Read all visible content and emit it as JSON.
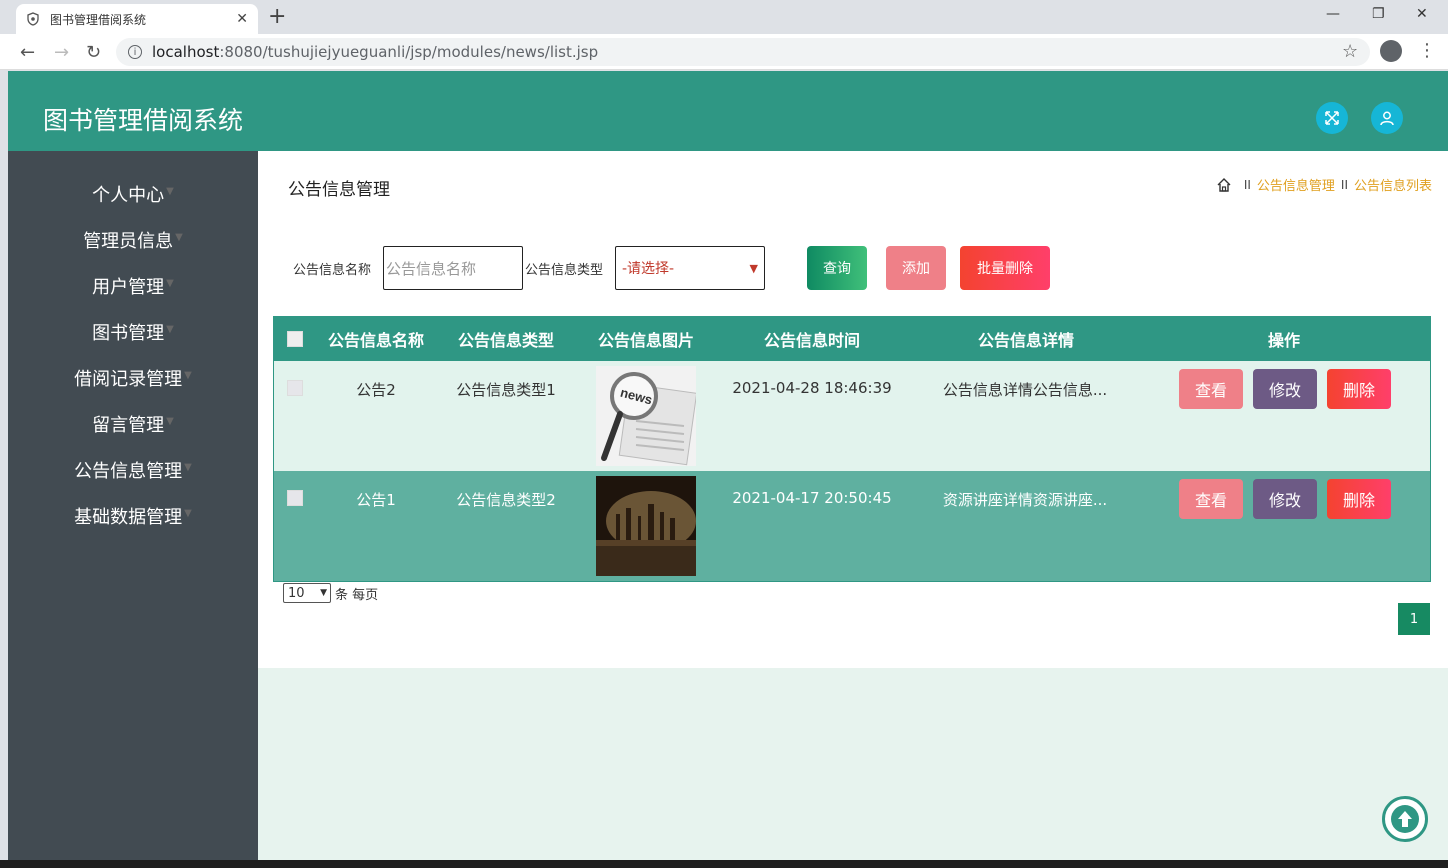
{
  "browser": {
    "tab_title": "图书管理借阅系统",
    "url_host": "localhost",
    "url_path": ":8080/tushujiejyueguanli/jsp/modules/news/list.jsp"
  },
  "app": {
    "brand": "图书管理借阅系统",
    "colors": {
      "header": "#2f9784",
      "sidebar": "#424b52",
      "accent": "#e0a020"
    }
  },
  "sidebar": {
    "items": [
      {
        "label": "个人中心"
      },
      {
        "label": "管理员信息"
      },
      {
        "label": "用户管理"
      },
      {
        "label": "图书管理"
      },
      {
        "label": "借阅记录管理"
      },
      {
        "label": "留言管理"
      },
      {
        "label": "公告信息管理"
      },
      {
        "label": "基础数据管理"
      }
    ]
  },
  "page": {
    "title": "公告信息管理",
    "breadcrumb": [
      "公告信息管理",
      "公告信息列表"
    ],
    "breadcrumb_sep": "II"
  },
  "filters": {
    "name_label": "公告信息名称",
    "name_placeholder": "公告信息名称",
    "type_label": "公告信息类型",
    "type_selected": "-请选择-",
    "query_label": "查询",
    "add_label": "添加",
    "batch_delete_label": "批量删除"
  },
  "table": {
    "headers": [
      "公告信息名称",
      "公告信息类型",
      "公告信息图片",
      "公告信息时间",
      "公告信息详情",
      "操作"
    ],
    "rows": [
      {
        "name": "公告2",
        "type": "公告信息类型1",
        "image": "news-image",
        "time": "2021-04-28 18:46:39",
        "detail": "公告信息详情公告信息..."
      },
      {
        "name": "公告1",
        "type": "公告信息类型2",
        "image": "city-image",
        "time": "2021-04-17 20:50:45",
        "detail": "资源讲座详情资源讲座..."
      }
    ],
    "actions": {
      "view": "查看",
      "edit": "修改",
      "delete": "删除"
    }
  },
  "pagination": {
    "page_size": "10",
    "page_size_suffix": "条 每页",
    "current_page": "1"
  }
}
